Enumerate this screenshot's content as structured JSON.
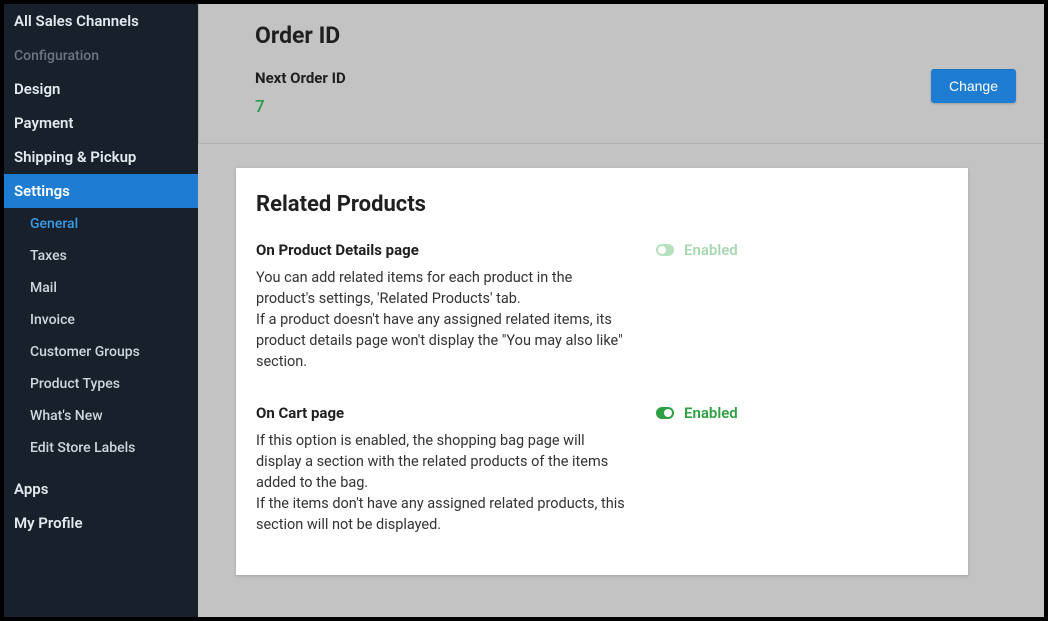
{
  "sidebar": {
    "all_sales": "All Sales Channels",
    "config_label": "Configuration",
    "items": [
      {
        "label": "Design"
      },
      {
        "label": "Payment"
      },
      {
        "label": "Shipping & Pickup"
      },
      {
        "label": "Settings"
      }
    ],
    "subitems": [
      {
        "label": "General"
      },
      {
        "label": "Taxes"
      },
      {
        "label": "Mail"
      },
      {
        "label": "Invoice"
      },
      {
        "label": "Customer Groups"
      },
      {
        "label": "Product Types"
      },
      {
        "label": "What's New"
      },
      {
        "label": "Edit Store Labels"
      }
    ],
    "apps": "Apps",
    "my_profile": "My Profile"
  },
  "order_id": {
    "title": "Order ID",
    "next_label": "Next Order ID",
    "value": "7",
    "change_btn": "Change"
  },
  "related": {
    "title": "Related Products",
    "block1": {
      "subtitle": "On Product Details page",
      "desc": "You can add related items for each product in the product's settings, 'Related Products' tab.\nIf a product doesn't have any assigned related items, its product details page won't display the \"You may also like\" section.",
      "toggle": "Enabled"
    },
    "block2": {
      "subtitle": "On Cart page",
      "desc": "If this option is enabled, the shopping bag page will display a section with the related products of the items added to the bag.\nIf the items don't have any assigned related products, this section will not be displayed.",
      "toggle": "Enabled"
    }
  }
}
